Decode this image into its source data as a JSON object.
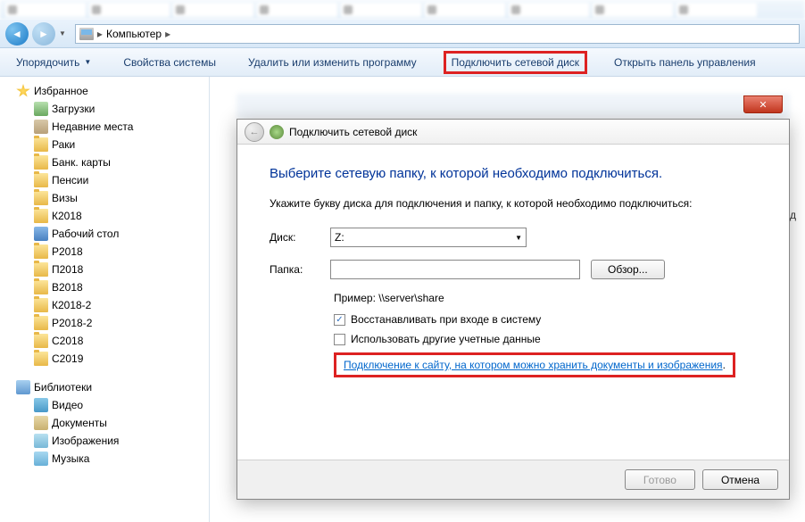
{
  "address": {
    "location": "Компьютер"
  },
  "toolbar": {
    "organize": "Упорядочить",
    "properties": "Свойства системы",
    "uninstall": "Удалить или изменить программу",
    "map_drive": "Подключить сетевой диск",
    "control_panel": "Открыть панель управления"
  },
  "sidebar": {
    "favorites": {
      "label": "Избранное"
    },
    "fav_items": [
      {
        "label": "Загрузки"
      },
      {
        "label": "Недавние места"
      },
      {
        "label": "Раки"
      },
      {
        "label": "Банк. карты"
      },
      {
        "label": "Пенсии"
      },
      {
        "label": "Визы"
      },
      {
        "label": "К2018"
      },
      {
        "label": "Рабочий стол"
      },
      {
        "label": "Р2018"
      },
      {
        "label": "П2018"
      },
      {
        "label": "В2018"
      },
      {
        "label": "К2018-2"
      },
      {
        "label": "Р2018-2"
      },
      {
        "label": "С2018"
      },
      {
        "label": "С2019"
      }
    ],
    "libraries": {
      "label": "Библиотеки"
    },
    "lib_items": [
      {
        "label": "Видео"
      },
      {
        "label": "Документы"
      },
      {
        "label": "Изображения"
      },
      {
        "label": "Музыка"
      }
    ]
  },
  "content_partial": "вод",
  "dialog": {
    "title": "Подключить сетевой диск",
    "heading": "Выберите сетевую папку, к которой необходимо подключиться.",
    "instruction": "Укажите букву диска для подключения и папку, к которой необходимо подключиться:",
    "drive_label": "Диск:",
    "drive_value": "Z:",
    "folder_label": "Папка:",
    "folder_value": "",
    "browse_btn": "Обзор...",
    "example": "Пример: \\\\server\\share",
    "reconnect_label": "Восстанавливать при входе в систему",
    "reconnect_checked": true,
    "alt_creds_label": "Использовать другие учетные данные",
    "alt_creds_checked": false,
    "link_text": "Подключение к сайту, на котором можно хранить документы и изображения",
    "finish_btn": "Готово",
    "cancel_btn": "Отмена"
  }
}
